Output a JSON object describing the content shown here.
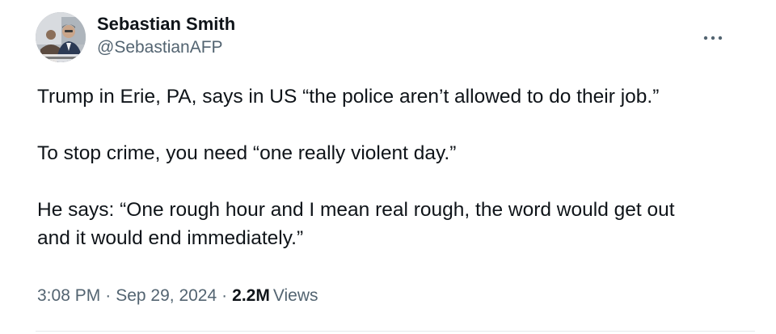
{
  "author": {
    "display_name": "Sebastian Smith",
    "handle": "@SebastianAFP"
  },
  "tweet": {
    "text": "Trump in Erie, PA, says in US “the police aren’t allowed to do their job.”\n\nTo stop crime, you need “one really violent day.”\n\nHe says: “One rough hour and I mean real rough, the word would get out\nand it would end immediately.”"
  },
  "meta": {
    "time": "3:08 PM",
    "separator": "·",
    "date": "Sep 29, 2024",
    "views_count": "2.2M",
    "views_label": "Views"
  },
  "icons": {
    "more": "more-horizontal-icon"
  },
  "colors": {
    "text": "#0f1419",
    "secondary": "#536471",
    "divider": "#e6e9ec"
  }
}
